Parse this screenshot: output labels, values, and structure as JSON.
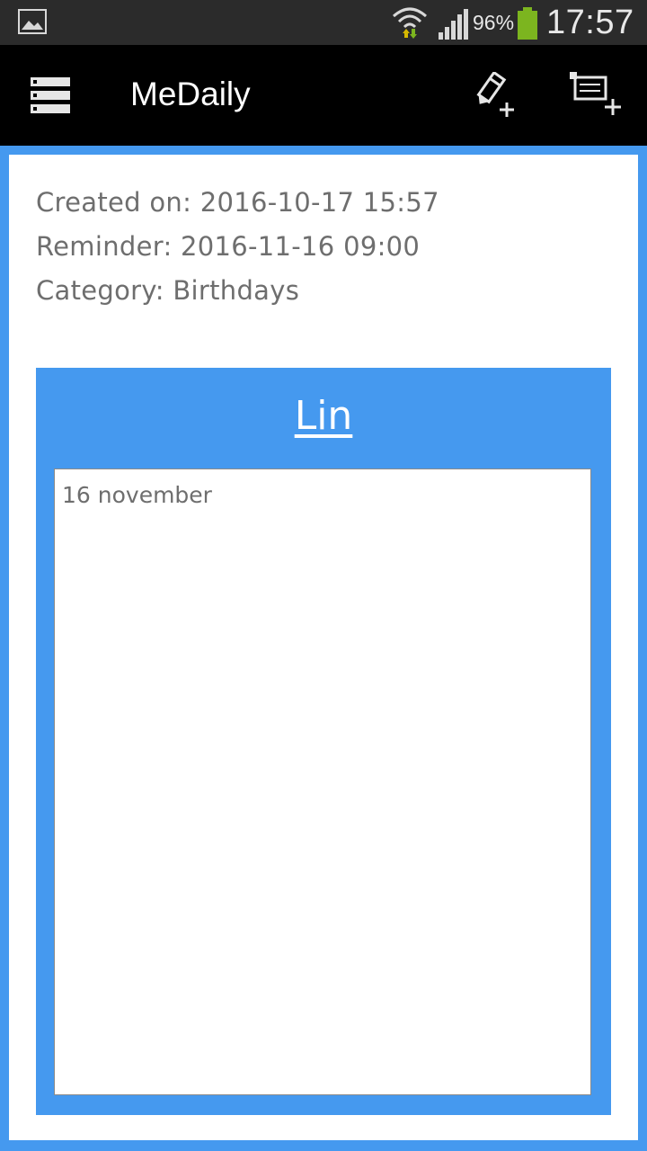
{
  "status_bar": {
    "battery_percent": "96%",
    "time": "17:57",
    "icons": [
      "gallery-icon",
      "wifi-icon",
      "signal-icon",
      "battery-icon"
    ],
    "battery_color": "#7cb51f"
  },
  "action_bar": {
    "title": "MeDaily",
    "icons": [
      "menu-icon",
      "new-note-icon",
      "new-category-icon"
    ]
  },
  "note": {
    "created_on": "Created on: 2016-10-17 15:57",
    "reminder": "Reminder: 2016-11-16 09:00",
    "category": "Category: Birthdays",
    "title": "Lin",
    "body": "16 november"
  },
  "colors": {
    "accent": "#4599ef",
    "action_bar": "#000000",
    "status_bar": "#2b2b2b",
    "text_gray": "#6e6e6e"
  }
}
